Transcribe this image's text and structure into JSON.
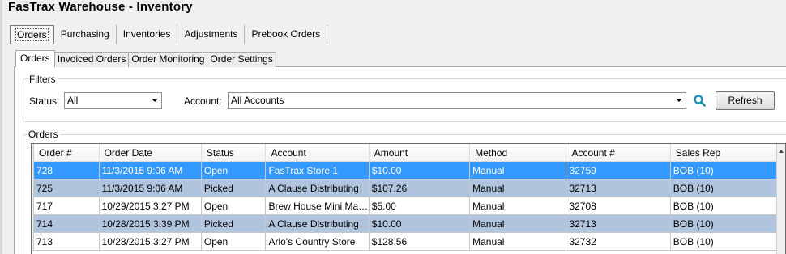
{
  "app": {
    "title": "FasTrax Warehouse - Inventory"
  },
  "top_tabs": [
    {
      "label": "Orders",
      "active": true
    },
    {
      "label": "Purchasing"
    },
    {
      "label": "Inventories"
    },
    {
      "label": "Adjustments"
    },
    {
      "label": "Prebook Orders"
    }
  ],
  "sub_tabs": [
    {
      "label": "Orders",
      "active": true
    },
    {
      "label": "Invoiced Orders"
    },
    {
      "label": "Order Monitoring"
    },
    {
      "label": "Order Settings"
    }
  ],
  "filters": {
    "group_label": "Filters",
    "status_label": "Status:",
    "status_value": "All",
    "account_label": "Account:",
    "account_value": "All Accounts",
    "search_icon": "search-icon",
    "refresh_label": "Refresh"
  },
  "orders": {
    "group_label": "Orders",
    "columns": [
      "Order #",
      "Order Date",
      "Status",
      "Account",
      "Amount",
      "Method",
      "Account #",
      "Sales Rep"
    ],
    "rows": [
      [
        "728",
        "11/3/2015 9:06 AM",
        "Open",
        "FasTrax Store 1",
        "$10.00",
        "Manual",
        "32759",
        "BOB (10)"
      ],
      [
        "725",
        "11/3/2015 9:06 AM",
        "Picked",
        "A Clause Distributing",
        "$107.26",
        "Manual",
        "32713",
        "BOB (10)"
      ],
      [
        "717",
        "10/29/2015 3:27 PM",
        "Open",
        "Brew House Mini Mart ...",
        "$5.00",
        "Manual",
        "32708",
        "BOB (10)"
      ],
      [
        "714",
        "10/28/2015 3:39 PM",
        "Picked",
        "A Clause Distributing",
        "$10.00",
        "Manual",
        "32713",
        "BOB (10)"
      ],
      [
        "713",
        "10/28/2015 3:27 PM",
        "Open",
        "Arlo's Country Store",
        "$128.56",
        "Manual",
        "32732",
        "BOB (10)"
      ]
    ]
  },
  "colors": {
    "selected_row": "#3399ff",
    "alt_row": "#b0c4de",
    "search_icon": "#1a8fb5"
  }
}
